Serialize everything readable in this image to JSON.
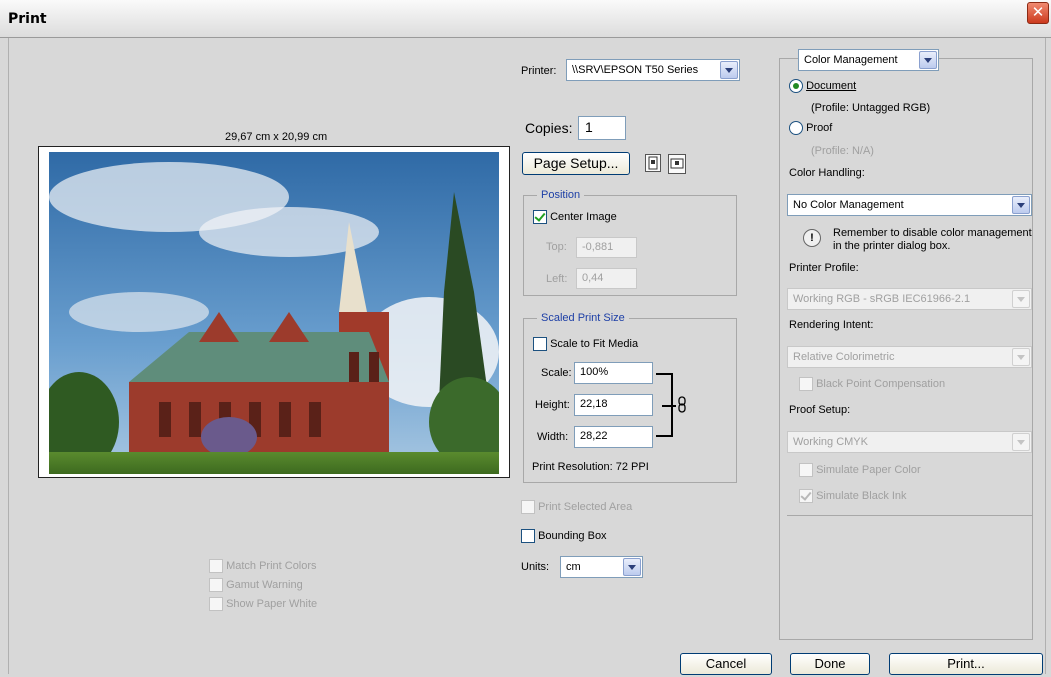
{
  "window": {
    "title": "Print",
    "close_glyph": "✕"
  },
  "preview": {
    "size_label": "29,67 cm x 20,99 cm"
  },
  "printer": {
    "label": "Printer:",
    "value": "\\\\SRV\\EPSON T50 Series"
  },
  "copies": {
    "label": "Copies:",
    "value": "1"
  },
  "page_setup": {
    "label": "Page Setup..."
  },
  "position": {
    "legend": "Position",
    "center_image": {
      "label": "Center Image",
      "checked": true
    },
    "top": {
      "label": "Top:",
      "value": "-0,881"
    },
    "left": {
      "label": "Left:",
      "value": "0,44"
    }
  },
  "scaled_print_size": {
    "legend": "Scaled Print Size",
    "scale_to_fit": {
      "label": "Scale to Fit Media",
      "checked": false
    },
    "scale": {
      "label": "Scale:",
      "value": "100%"
    },
    "height": {
      "label": "Height:",
      "value": "22,18"
    },
    "width": {
      "label": "Width:",
      "value": "28,22"
    },
    "resolution": "Print Resolution: 72 PPI"
  },
  "options": {
    "print_selected_area": "Print Selected Area",
    "bounding_box": "Bounding Box",
    "units_label": "Units:",
    "units_value": "cm"
  },
  "left_options": {
    "match_print_colors": "Match Print Colors",
    "gamut_warning": "Gamut Warning",
    "show_paper_white": "Show Paper White"
  },
  "color_mgmt": {
    "dropdown": "Color Management",
    "document": {
      "label": "Document",
      "selected": true
    },
    "document_profile": "(Profile: Untagged RGB)",
    "proof": {
      "label": "Proof",
      "selected": false
    },
    "proof_profile": "(Profile: N/A)",
    "color_handling_label": "Color Handling:",
    "color_handling_value": "No Color Management",
    "warning_line1": "Remember to disable color management",
    "warning_line2": "in the printer dialog box.",
    "printer_profile_label": "Printer Profile:",
    "printer_profile_value": "Working RGB - sRGB IEC61966-2.1",
    "rendering_intent_label": "Rendering Intent:",
    "rendering_intent_value": "Relative Colorimetric",
    "bpc": "Black Point Compensation",
    "proof_setup_label": "Proof Setup:",
    "proof_setup_value": "Working CMYK",
    "simulate_paper": "Simulate Paper Color",
    "simulate_black": "Simulate Black Ink"
  },
  "buttons": {
    "cancel": "Cancel",
    "done": "Done",
    "print": "Print..."
  }
}
